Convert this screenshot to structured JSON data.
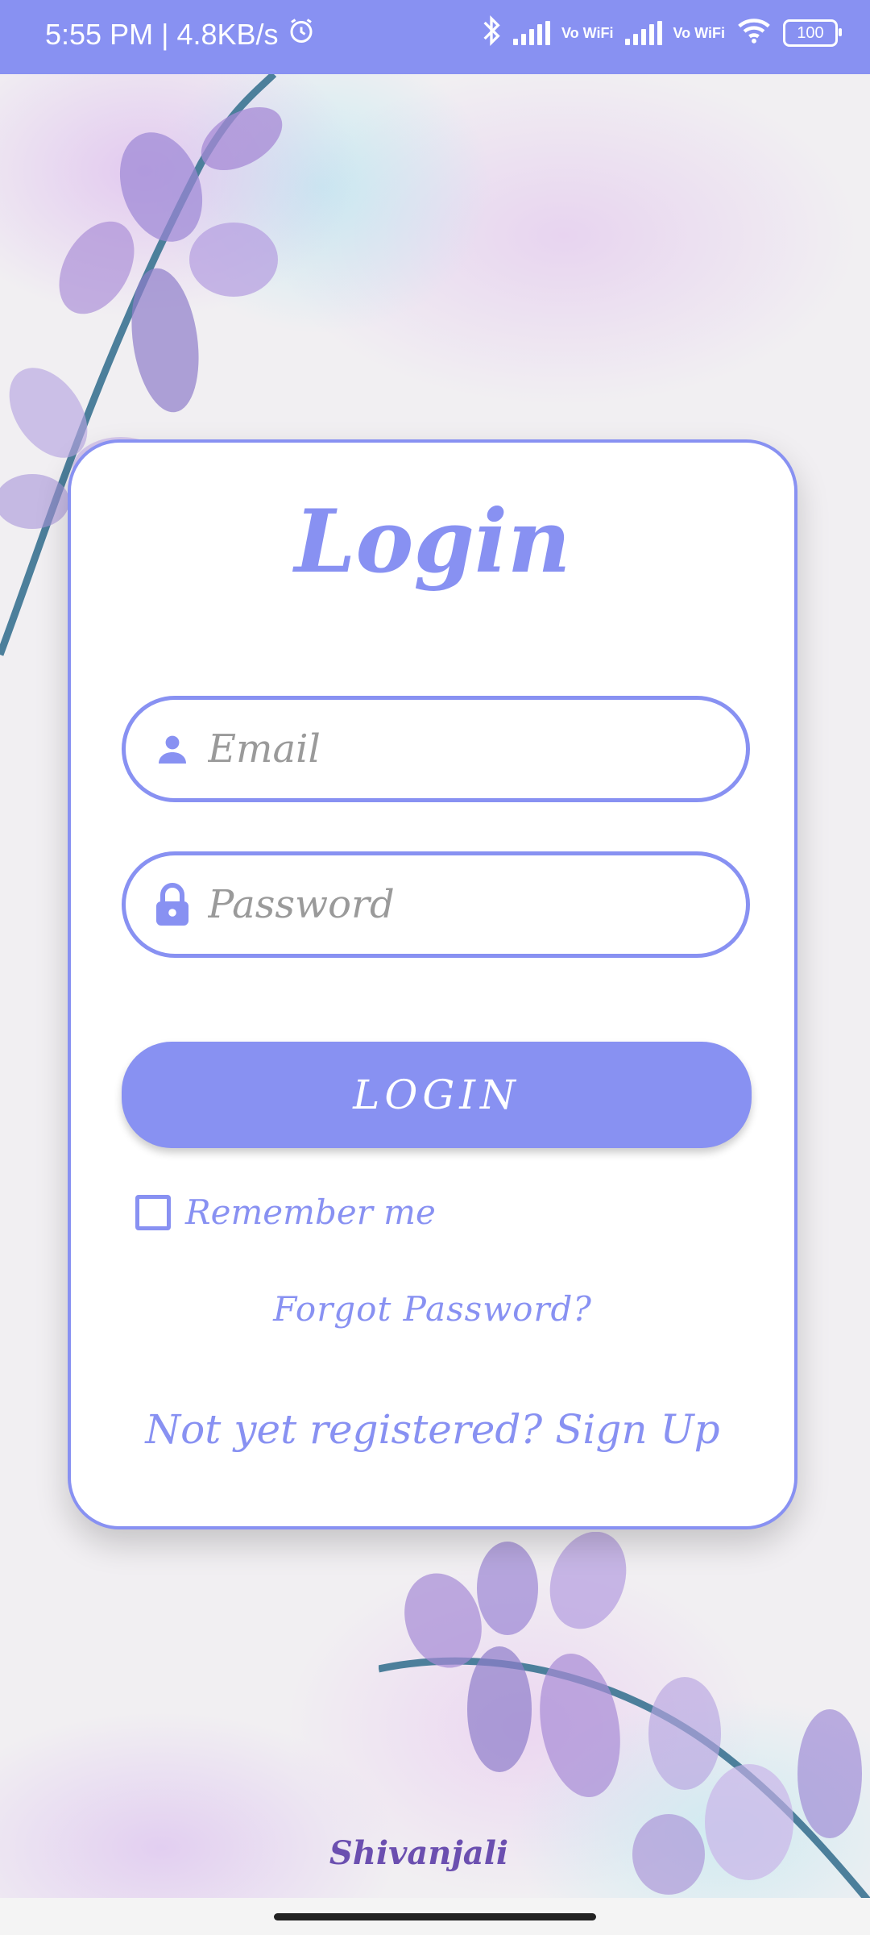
{
  "status_bar": {
    "time": "5:55 PM",
    "separator": "|",
    "network_speed": "4.8KB/s",
    "vo_wifi_label_1": "Vo WiFi",
    "vo_wifi_label_2": "Vo WiFi",
    "battery": "100",
    "icons": [
      "alarm-icon",
      "bluetooth-icon",
      "signal-icon",
      "wifi-icon",
      "battery-icon"
    ],
    "background_color": "#8891f2"
  },
  "login_card": {
    "title": "Login",
    "email": {
      "placeholder": "Email",
      "value": "",
      "icon": "person-icon"
    },
    "password": {
      "placeholder": "Password",
      "value": "",
      "icon": "lock-icon"
    },
    "login_button": "LOGIN",
    "remember_me": {
      "label": "Remember me",
      "checked": false
    },
    "forgot_password": "Forgot Password?",
    "signup_prompt": "Not yet registered? Sign Up"
  },
  "footer": {
    "brand": "Shivanjali"
  },
  "colors": {
    "accent": "#8891f2",
    "placeholder": "#9a9a9a",
    "brand": "#6b4fb0"
  }
}
